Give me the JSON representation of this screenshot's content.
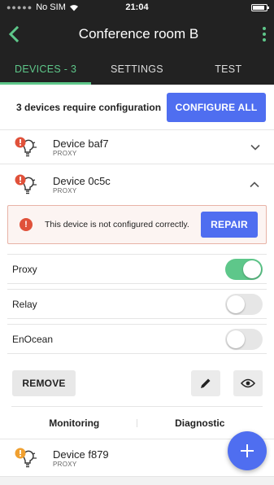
{
  "status_bar": {
    "carrier": "No SIM",
    "time": "21:04"
  },
  "header": {
    "title": "Conference room B"
  },
  "tabs": [
    {
      "label": "DEVICES - 3",
      "active": true
    },
    {
      "label": "SETTINGS",
      "active": false
    },
    {
      "label": "TEST",
      "active": false
    }
  ],
  "config_banner": {
    "message": "3 devices require configuration",
    "button_label": "CONFIGURE ALL"
  },
  "devices": [
    {
      "name": "Device baf7",
      "type": "PROXY",
      "status": "error",
      "expanded": false
    },
    {
      "name": "Device 0c5c",
      "type": "PROXY",
      "status": "error",
      "expanded": true
    },
    {
      "name": "Device f879",
      "type": "PROXY",
      "status": "warning",
      "expanded": false
    }
  ],
  "expanded_panel": {
    "warning_text": "This device is not configured correctly.",
    "repair_label": "REPAIR",
    "toggles": [
      {
        "label": "Proxy",
        "on": true
      },
      {
        "label": "Relay",
        "on": false
      },
      {
        "label": "EnOcean",
        "on": false
      }
    ],
    "remove_label": "REMOVE",
    "subtabs": [
      "Monitoring",
      "Diagnostic"
    ]
  },
  "colors": {
    "accent": "#5ec78a",
    "primary": "#4f6ef0",
    "error": "#e0513a",
    "warning": "#f0a030"
  }
}
